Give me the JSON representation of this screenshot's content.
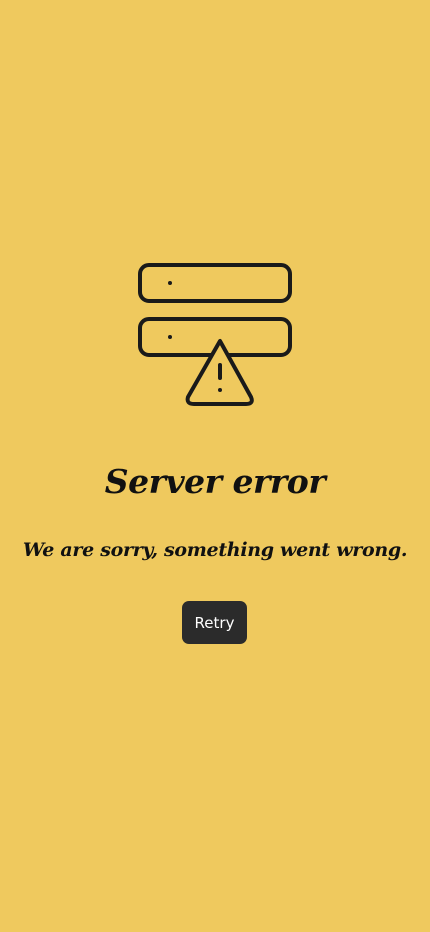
{
  "theme": {
    "background": "#EFC95E",
    "text_color": "#111111",
    "button_background": "#2B2B2B",
    "button_text": "#FFFFFF",
    "icon_stroke": "#1A1A1A"
  },
  "illustration": {
    "icon": "server-warning-icon"
  },
  "error": {
    "title": "Server error",
    "message": "We are sorry, something went wrong.",
    "retry_label": "Retry"
  }
}
